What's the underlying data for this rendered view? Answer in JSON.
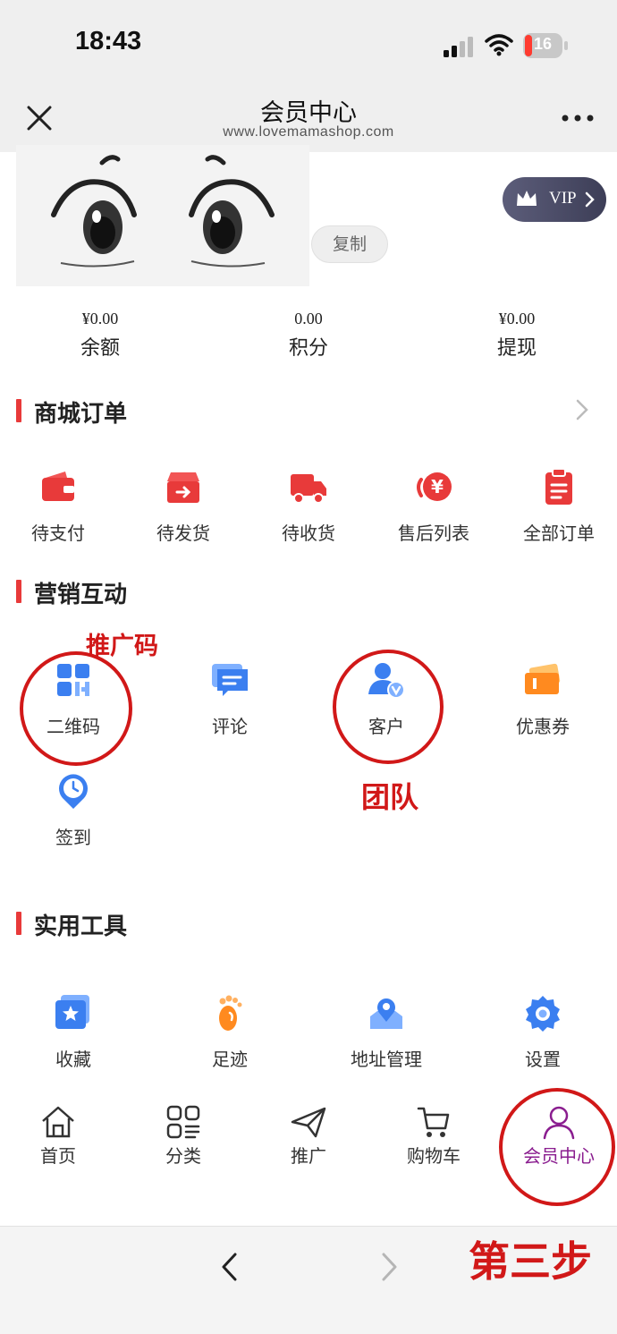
{
  "status_bar": {
    "time": "18:43",
    "battery": "16"
  },
  "nav": {
    "title": "会员中心",
    "url": "www.lovemamashop.com"
  },
  "profile": {
    "copy_label": "复制",
    "vip_label": "VIP"
  },
  "stats": [
    {
      "value": "¥0.00",
      "label": "余额"
    },
    {
      "value": "0.00",
      "label": "积分"
    },
    {
      "value": "¥0.00",
      "label": "提现"
    }
  ],
  "sections": {
    "orders": {
      "title": "商城订单",
      "items": [
        {
          "label": "待支付",
          "icon": "wallet-icon"
        },
        {
          "label": "待发货",
          "icon": "box-icon"
        },
        {
          "label": "待收货",
          "icon": "truck-icon"
        },
        {
          "label": "售后列表",
          "icon": "refund-icon"
        },
        {
          "label": "全部订单",
          "icon": "clipboard-icon"
        }
      ]
    },
    "marketing": {
      "title": "营销互动",
      "items": [
        {
          "label": "二维码",
          "icon": "qr-code-icon"
        },
        {
          "label": "评论",
          "icon": "comment-icon"
        },
        {
          "label": "客户",
          "icon": "customer-icon"
        },
        {
          "label": "优惠券",
          "icon": "coupon-icon"
        },
        {
          "label": "签到",
          "icon": "check-in-icon"
        }
      ]
    },
    "tools": {
      "title": "实用工具",
      "items": [
        {
          "label": "收藏",
          "icon": "favorite-icon"
        },
        {
          "label": "足迹",
          "icon": "footprint-icon"
        },
        {
          "label": "地址管理",
          "icon": "address-icon"
        },
        {
          "label": "设置",
          "icon": "settings-icon"
        }
      ]
    }
  },
  "tabbar": [
    {
      "label": "首页",
      "icon": "home-icon"
    },
    {
      "label": "分类",
      "icon": "category-icon"
    },
    {
      "label": "推广",
      "icon": "paper-plane-icon"
    },
    {
      "label": "购物车",
      "icon": "cart-icon"
    },
    {
      "label": "会员中心",
      "icon": "user-icon",
      "active": true
    }
  ],
  "annotations": {
    "qr": "推广码",
    "customer": "团队",
    "step": "第三步"
  },
  "colors": {
    "accent_red": "#e83a3a",
    "annotation_red": "#d11818",
    "active_tab": "#8a1d8f",
    "icon_blue": "#3b7ff0",
    "icon_orange": "#ff8a1f"
  }
}
